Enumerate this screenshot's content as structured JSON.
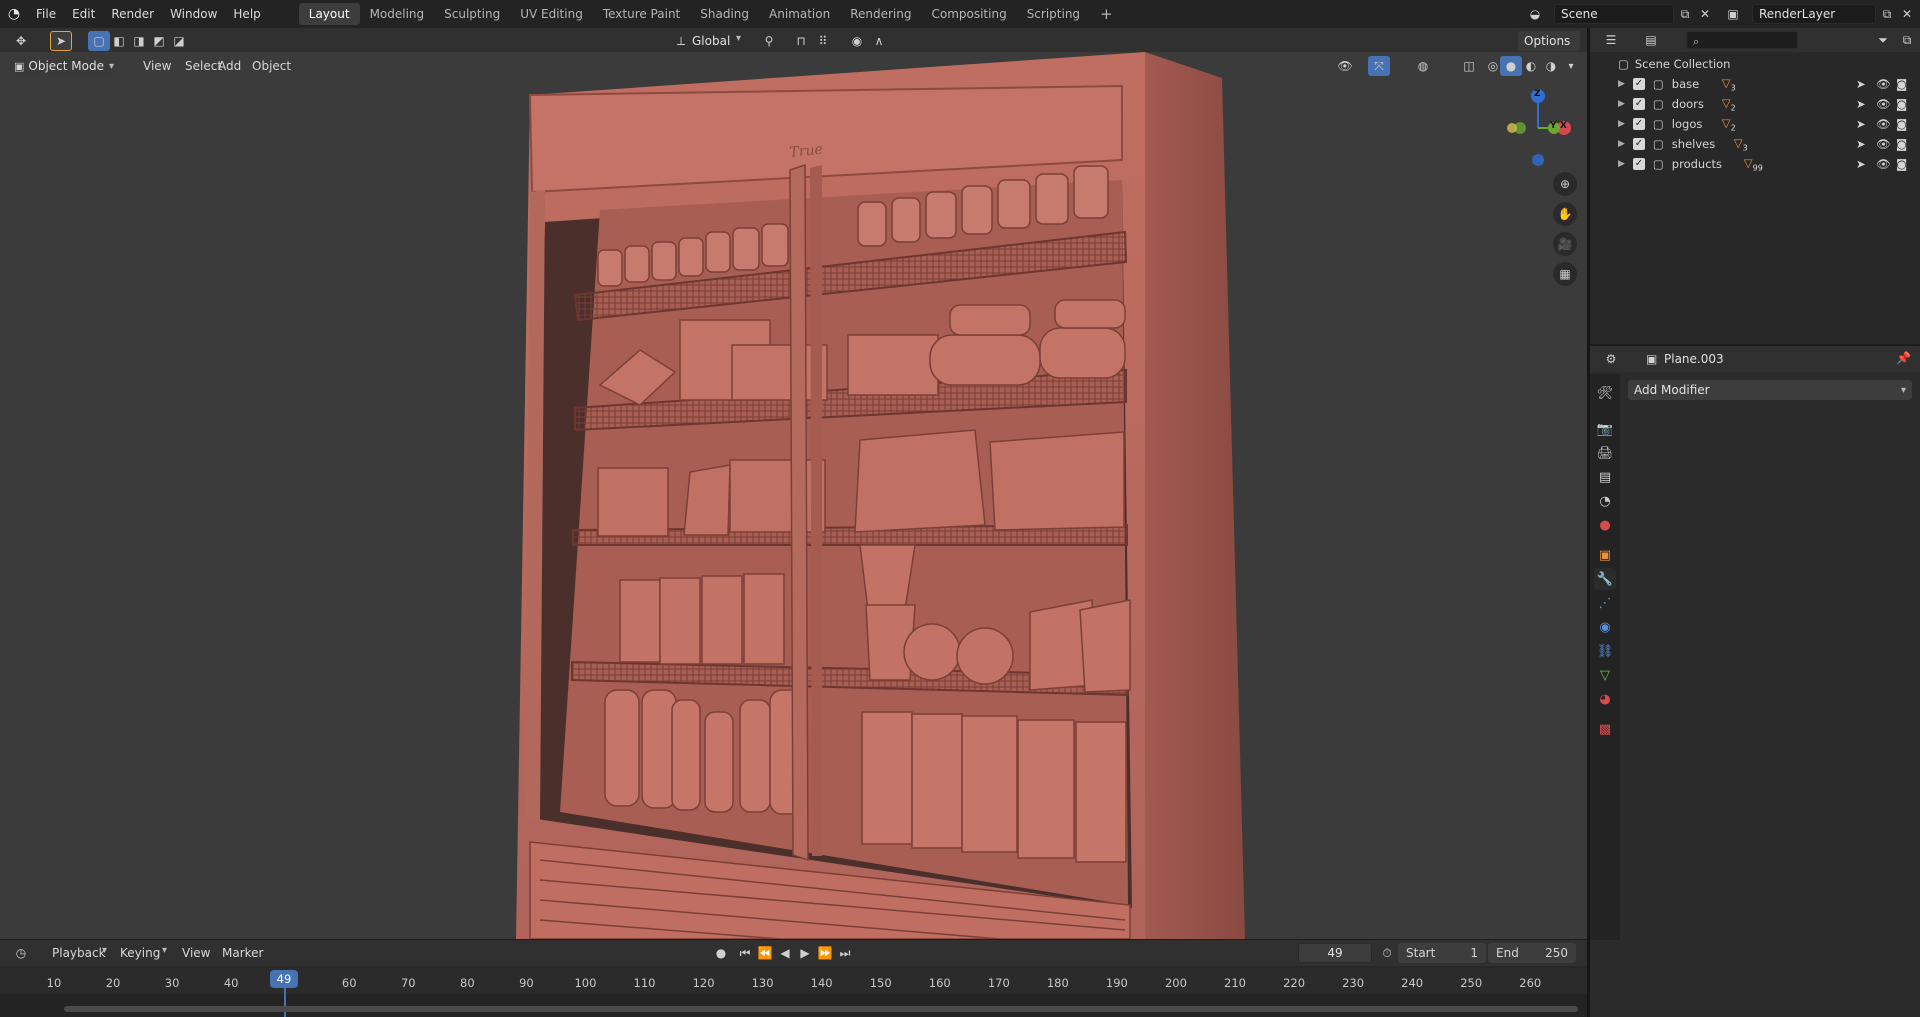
{
  "topbar": {
    "menus": [
      "File",
      "Edit",
      "Render",
      "Window",
      "Help"
    ],
    "workspaces": [
      "Layout",
      "Modeling",
      "Sculpting",
      "UV Editing",
      "Texture Paint",
      "Shading",
      "Animation",
      "Rendering",
      "Compositing",
      "Scripting"
    ],
    "active_workspace": "Layout",
    "add_tab": "+",
    "scene": "Scene",
    "render_layer": "RenderLayer"
  },
  "viewport": {
    "mode": "Object Mode",
    "menus": [
      "View",
      "Select",
      "Add",
      "Object"
    ],
    "orientation": "Global",
    "options_label": "Options",
    "gizmo": {
      "z": "Z",
      "x": "X",
      "y": "Y"
    },
    "object_icon_text": "True",
    "mesh_color": "#b9665a"
  },
  "outliner": {
    "search_placeholder": "",
    "root": "Scene Collection",
    "items": [
      {
        "name": "base",
        "count": "3"
      },
      {
        "name": "doors",
        "count": "2"
      },
      {
        "name": "logos",
        "count": "2"
      },
      {
        "name": "shelves",
        "count": "3"
      },
      {
        "name": "products",
        "count": "99"
      }
    ]
  },
  "properties": {
    "object_name": "Plane.003",
    "add_modifier": "Add Modifier"
  },
  "timeline": {
    "menus": [
      "Playback",
      "Keying",
      "View",
      "Marker"
    ],
    "current_frame": "49",
    "start_label": "Start",
    "start": "1",
    "end_label": "End",
    "end": "250",
    "ticks": [
      "10",
      "20",
      "30",
      "40",
      "49",
      "60",
      "70",
      "80",
      "90",
      "100",
      "110",
      "120",
      "130",
      "140",
      "150",
      "160",
      "170",
      "180",
      "190",
      "200",
      "210",
      "220",
      "230",
      "240",
      "250",
      "260"
    ],
    "playhead_color": "#4772b3"
  }
}
